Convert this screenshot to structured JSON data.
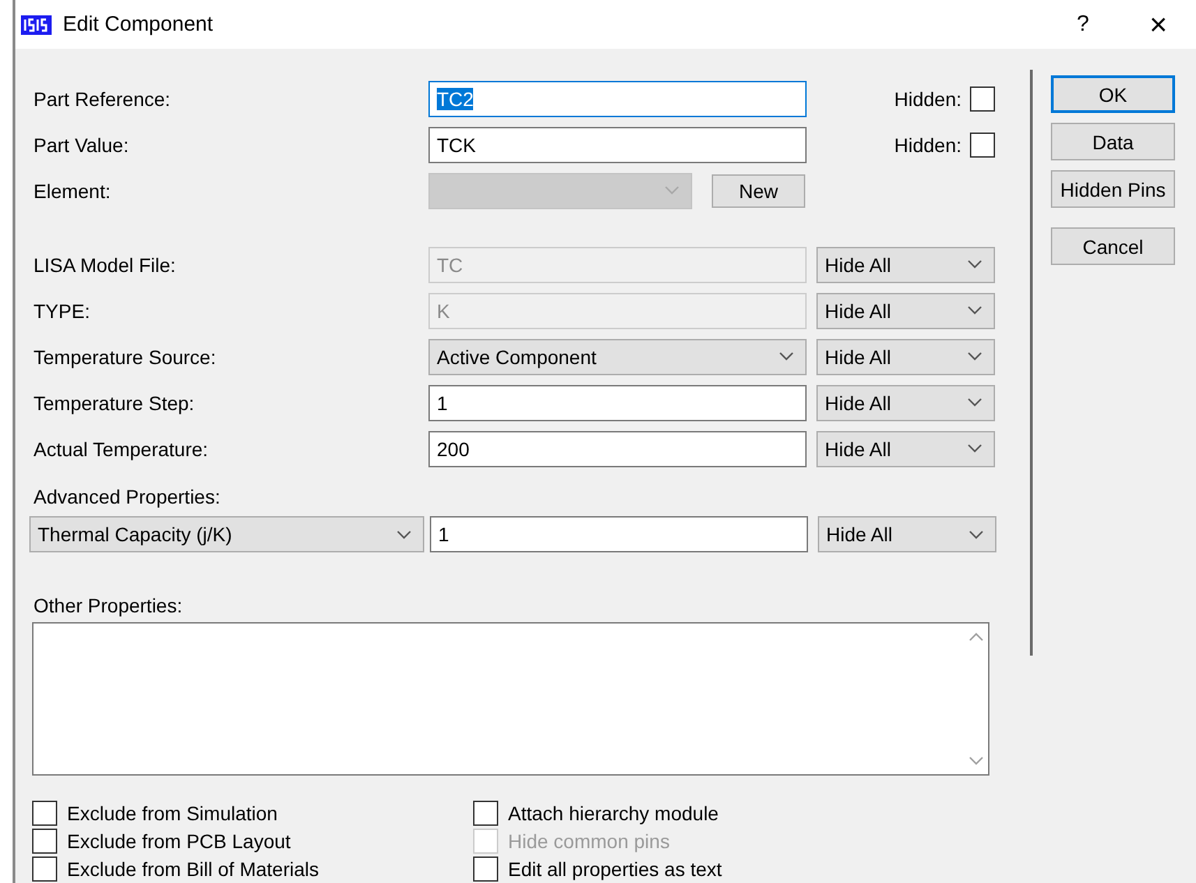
{
  "window": {
    "title": "Edit Component",
    "help": "?",
    "close": "×"
  },
  "component_rows": [
    {
      "kind": "text",
      "label": "Part Reference:",
      "value": "TC2",
      "focused": true,
      "disabled": false,
      "hidden": {
        "label": "Hidden:",
        "checked": false
      }
    },
    {
      "kind": "text",
      "label": "Part Value:",
      "value": "TCK",
      "focused": false,
      "disabled": false,
      "hidden": {
        "label": "Hidden:",
        "checked": false
      }
    },
    {
      "kind": "combo",
      "label": "Element:",
      "disabled": true,
      "button": "New"
    }
  ],
  "property_rows": [
    {
      "kind": "text",
      "label": "LISA Model File:",
      "value": "TC",
      "focused": false,
      "disabled": true,
      "visibility": "Hide All"
    },
    {
      "kind": "text",
      "label": "TYPE:",
      "value": "K",
      "focused": false,
      "disabled": true,
      "visibility": "Hide All"
    },
    {
      "kind": "combo",
      "label": "Temperature Source:",
      "value": "Active Component",
      "disabled": false,
      "visibility": "Hide All"
    },
    {
      "kind": "text",
      "label": "Temperature Step:",
      "value": "1",
      "focused": false,
      "disabled": false,
      "visibility": "Hide All"
    },
    {
      "kind": "text",
      "label": "Actual Temperature:",
      "value": "200",
      "focused": false,
      "disabled": false,
      "visibility": "Hide All"
    }
  ],
  "advanced": {
    "label": "Advanced Properties:",
    "property": "Thermal Capacity (j/K)",
    "value": "1",
    "visibility": "Hide All"
  },
  "other_properties": {
    "label": "Other Properties:"
  },
  "checkboxes": [
    {
      "label": "Exclude from Simulation",
      "checked": false,
      "disabled": false
    },
    {
      "label": "Exclude from PCB Layout",
      "checked": false,
      "disabled": false
    },
    {
      "label": "Exclude from Bill of Materials",
      "checked": false,
      "disabled": false
    },
    {
      "label": "Attach hierarchy module",
      "checked": false,
      "disabled": false
    },
    {
      "label": "Hide common pins",
      "checked": false,
      "disabled": true
    },
    {
      "label": "Edit all properties as text",
      "checked": false,
      "disabled": false
    }
  ],
  "buttons": [
    {
      "label": "OK",
      "default": true
    },
    {
      "label": "Data",
      "default": false
    },
    {
      "label": "Hidden Pins",
      "default": false
    },
    {
      "label": "Cancel",
      "default": false
    }
  ]
}
